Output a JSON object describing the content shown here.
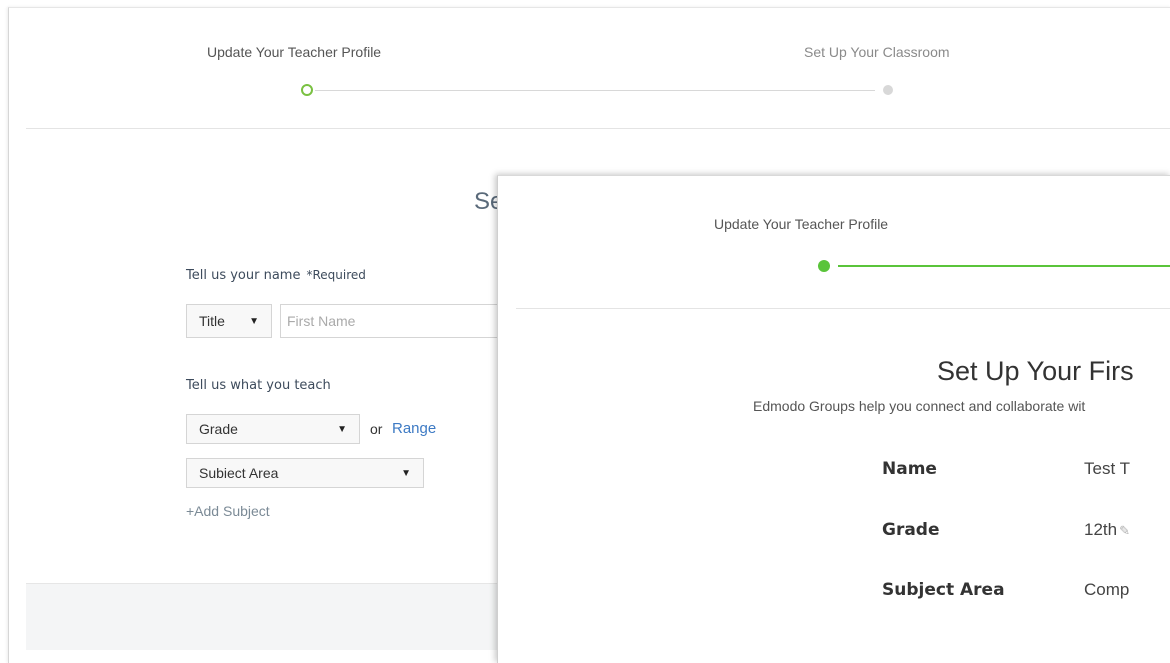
{
  "background_window": {
    "steps": [
      {
        "label": "Update Your Teacher Profile"
      },
      {
        "label": "Set Up Your Classroom"
      }
    ],
    "partial_heading": "Se",
    "name_section": {
      "label": "Tell us your name",
      "required": "*Required",
      "title_select": "Title",
      "first_name_placeholder": "First Name"
    },
    "teach_section": {
      "label": "Tell us what you teach",
      "grade_select": "Grade",
      "or_text": "or",
      "range_link": "Range",
      "subject_select": "Subiect Area",
      "add_subject": "+Add Subject"
    }
  },
  "front_window": {
    "step_label": "Update Your Teacher Profile",
    "title": "Set Up Your Firs",
    "subtitle": "Edmodo Groups help you connect and collaborate wit",
    "fields": [
      {
        "key": "Name",
        "value": "Test T"
      },
      {
        "key": "Grade",
        "value": "12th"
      },
      {
        "key": "Subject Area",
        "value": "Comp"
      }
    ]
  },
  "colors": {
    "accent_green": "#5ac43a",
    "link_blue": "#3d7ac4"
  }
}
